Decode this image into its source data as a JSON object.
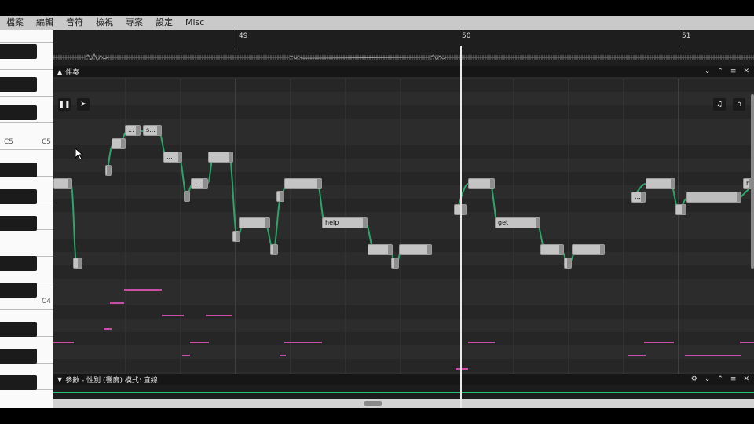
{
  "menu": [
    "檔案",
    "編輯",
    "音符",
    "檢視",
    "專案",
    "設定",
    "Misc"
  ],
  "timeline": {
    "bars": [
      "49",
      "50",
      "51"
    ]
  },
  "piano": {
    "labels": [
      "C5",
      "C5",
      "C4"
    ]
  },
  "panel": {
    "title": "伴奏",
    "header_icons": [
      "chevron-down-icon",
      "chevron-up-icon",
      "maximize-icon",
      "close-icon"
    ]
  },
  "toolbar": {
    "left_icons": [
      "pause-icon",
      "pointer-icon"
    ],
    "right_icons": [
      "music-note-icon",
      "headphones-icon"
    ]
  },
  "notes": [
    {
      "lyric": ""
    },
    {
      "lyric": ""
    },
    {
      "lyric": ""
    },
    {
      "lyric": ""
    },
    {
      "lyric": "..."
    },
    {
      "lyric": "s..."
    },
    {
      "lyric": "..."
    },
    {
      "lyric": ""
    },
    {
      "lyric": "..."
    },
    {
      "lyric": ""
    },
    {
      "lyric": ""
    },
    {
      "lyric": ""
    },
    {
      "lyric": ""
    },
    {
      "lyric": ""
    },
    {
      "lyric": ""
    },
    {
      "lyric": "help"
    },
    {
      "lyric": ""
    },
    {
      "lyric": ""
    },
    {
      "lyric": ""
    },
    {
      "lyric": ""
    },
    {
      "lyric": ""
    },
    {
      "lyric": "get"
    },
    {
      "lyric": ""
    },
    {
      "lyric": ""
    },
    {
      "lyric": ""
    },
    {
      "lyric": "..."
    },
    {
      "lyric": ""
    },
    {
      "lyric": ""
    },
    {
      "lyric": ""
    },
    {
      "lyric": "h"
    }
  ],
  "param_panel": {
    "title": "參數 - 性別 (響度) 模式: 直線",
    "header_icons": [
      "settings-icon",
      "chevron-down-icon",
      "chevron-up-icon",
      "maximize-icon",
      "close-icon"
    ]
  },
  "colors": {
    "pitch_curve": "#2fa36b",
    "accompaniment": "#c94ea8",
    "param_line": "#27c07a"
  }
}
